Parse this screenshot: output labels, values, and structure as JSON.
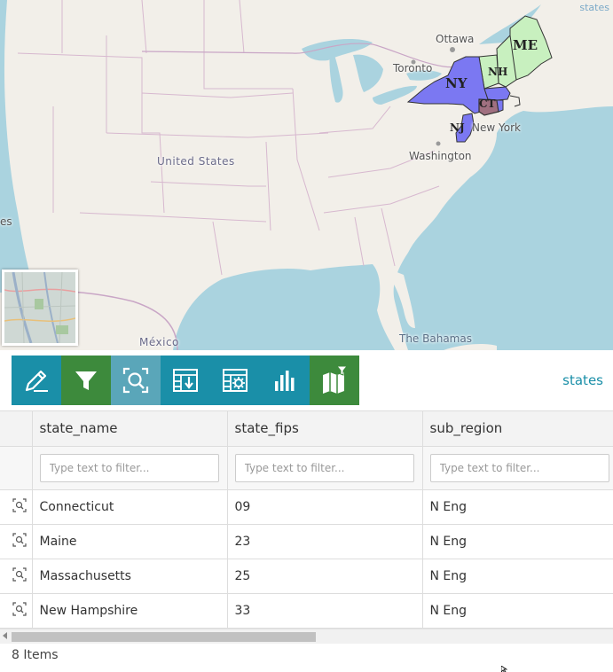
{
  "map": {
    "attribution": "states",
    "labels": {
      "ottawa": "Ottawa",
      "toronto": "Toronto",
      "new_york": "New York",
      "washington": "Washington",
      "united_states": "United States",
      "mexico": "México",
      "bahamas": "The Bahamas",
      "edge_left": "es"
    },
    "state_labels": {
      "ny": "NY",
      "me": "ME",
      "nh": "NH",
      "ct": "CT",
      "nj": "NJ"
    },
    "colors": {
      "new_england_fill": "#c8f0bf",
      "mid_atlantic_fill": "#7b78f2",
      "selected_fill": "#a07080",
      "water": "#aad3df",
      "land": "#f2efe9"
    }
  },
  "toolbar": {
    "tools": [
      {
        "icon": "pencil-icon",
        "color": "#1a8fa8"
      },
      {
        "icon": "filter-icon",
        "color": "#3d8a3c"
      },
      {
        "icon": "zoom-to-selection-icon",
        "color": "#5aa6b9"
      },
      {
        "icon": "table-download-icon",
        "color": "#1a8fa8"
      },
      {
        "icon": "table-settings-icon",
        "color": "#1a8fa8"
      },
      {
        "icon": "bar-chart-icon",
        "color": "#1a8fa8"
      },
      {
        "icon": "map-filter-icon",
        "color": "#3d8a3c"
      }
    ],
    "layer_name": "states"
  },
  "grid": {
    "columns": [
      "state_name",
      "state_fips",
      "sub_region"
    ],
    "filter_placeholder": "Type text to filter...",
    "rows": [
      {
        "state_name": "Connecticut",
        "state_fips": "09",
        "sub_region": "N Eng"
      },
      {
        "state_name": "Maine",
        "state_fips": "23",
        "sub_region": "N Eng"
      },
      {
        "state_name": "Massachusetts",
        "state_fips": "25",
        "sub_region": "N Eng"
      },
      {
        "state_name": "New Hampshire",
        "state_fips": "33",
        "sub_region": "N Eng"
      }
    ]
  },
  "footer": {
    "item_count": "8 Items"
  }
}
